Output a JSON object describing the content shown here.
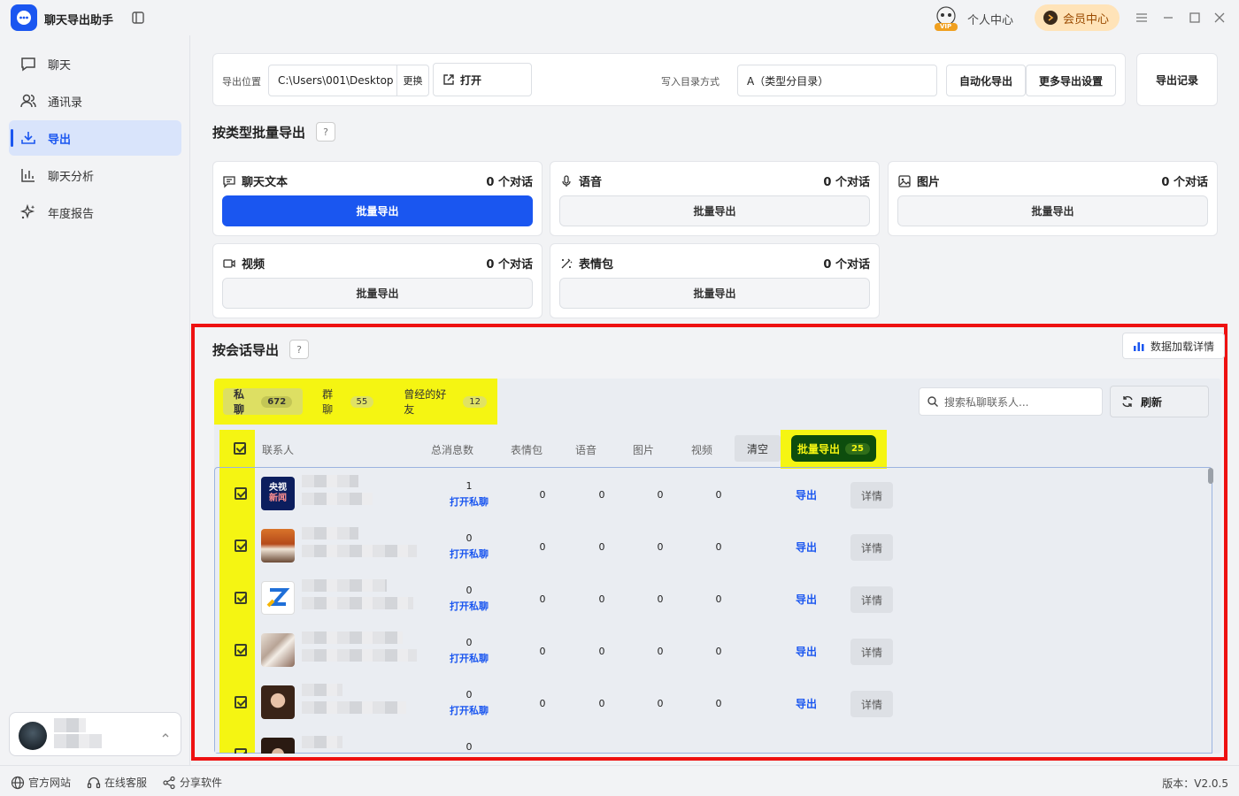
{
  "app": {
    "title": "聊天导出助手"
  },
  "header": {
    "personal_center": "个人中心",
    "member_center": "会员中心",
    "vip_badge": "VIP"
  },
  "sidebar": {
    "items": [
      {
        "label": "聊天",
        "icon": "chat-icon"
      },
      {
        "label": "通讯录",
        "icon": "contacts-icon"
      },
      {
        "label": "导出",
        "icon": "download-icon",
        "active": true
      },
      {
        "label": "聊天分析",
        "icon": "bar-chart-icon"
      },
      {
        "label": "年度报告",
        "icon": "sparkle-icon"
      }
    ]
  },
  "toolbar": {
    "export_location_label": "导出位置",
    "export_path": "C:\\Users\\001\\Desktop",
    "change_label": "更换",
    "open_label": "打开",
    "write_mode_label": "写入目录方式",
    "write_mode_value": "A（类型分目录）",
    "auto_export_label": "自动化导出",
    "more_settings_label": "更多导出设置",
    "records_label": "导出记录"
  },
  "batch_by_type": {
    "title": "按类型批量导出",
    "help": "?",
    "cards": [
      {
        "label": "聊天文本",
        "icon": "message-square-icon",
        "count": "0 个对话",
        "button": "批量导出",
        "primary": true
      },
      {
        "label": "语音",
        "icon": "microphone-icon",
        "count": "0 个对话",
        "button": "批量导出"
      },
      {
        "label": "图片",
        "icon": "image-icon",
        "count": "0 个对话",
        "button": "批量导出"
      },
      {
        "label": "视频",
        "icon": "video-icon",
        "count": "0 个对话",
        "button": "批量导出"
      },
      {
        "label": "表情包",
        "icon": "magic-wand-icon",
        "count": "0 个对话",
        "button": "批量导出"
      }
    ]
  },
  "by_session": {
    "title": "按会话导出",
    "help": "?",
    "load_details_label": "数据加载详情",
    "tabs": [
      {
        "label": "私聊",
        "count": "672",
        "active": true
      },
      {
        "label": "群聊",
        "count": "55"
      },
      {
        "label": "曾经的好友",
        "count": "12"
      }
    ],
    "search_placeholder": "搜索私聊联系人...",
    "refresh_label": "刷新",
    "columns": {
      "contact": "联系人",
      "total": "总消息数",
      "sticker": "表情包",
      "voice": "语音",
      "image": "图片",
      "video": "视频"
    },
    "clear_label": "清空",
    "batch_export_label": "批量导出",
    "batch_export_count": "25",
    "rows": [
      {
        "total": "1",
        "open": "打开私聊",
        "sticker": "0",
        "voice": "0",
        "image": "0",
        "video": "0",
        "export": "导出",
        "details": "详情",
        "avatar": "cctv-news"
      },
      {
        "total": "0",
        "open": "打开私聊",
        "sticker": "0",
        "voice": "0",
        "image": "0",
        "video": "0",
        "export": "导出",
        "details": "详情",
        "avatar": "orange-room"
      },
      {
        "total": "0",
        "open": "打开私聊",
        "sticker": "0",
        "voice": "0",
        "image": "0",
        "video": "0",
        "export": "导出",
        "details": "详情",
        "avatar": "z-logo"
      },
      {
        "total": "0",
        "open": "打开私聊",
        "sticker": "0",
        "voice": "0",
        "image": "0",
        "video": "0",
        "export": "导出",
        "details": "详情",
        "avatar": "interior"
      },
      {
        "total": "0",
        "open": "打开私聊",
        "sticker": "0",
        "voice": "0",
        "image": "0",
        "video": "0",
        "export": "导出",
        "details": "详情",
        "avatar": "portrait"
      },
      {
        "total": "0",
        "open": "",
        "sticker": "",
        "voice": "",
        "image": "",
        "video": "",
        "export": "",
        "details": "",
        "avatar": "portrait-2"
      }
    ],
    "avatar_text": {
      "cctv_line1": "央视",
      "cctv_line2": "新闻"
    }
  },
  "footer": {
    "website": "官方网站",
    "support": "在线客服",
    "share": "分享软件",
    "version": "版本：V2.0.5"
  },
  "colors": {
    "accent": "#1a56f0",
    "highlight": "#f5f512",
    "alert": "#ee1111"
  }
}
